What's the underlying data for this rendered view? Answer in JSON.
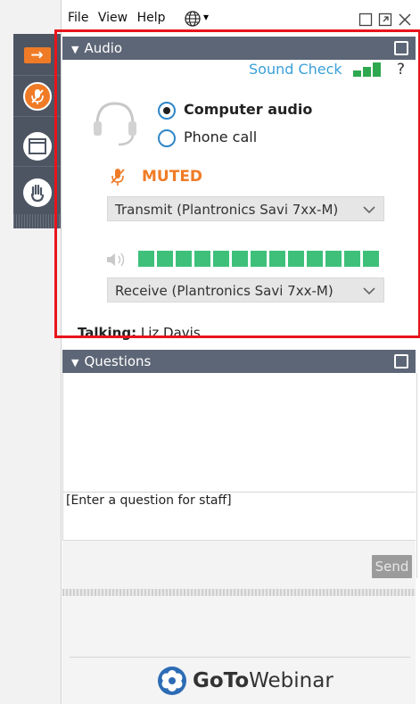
{
  "menu": {
    "file": "File",
    "view": "View",
    "help": "Help",
    "globe_icon": "globe-icon",
    "globe_caret": "▾"
  },
  "window_controls": [
    "restore-icon",
    "popout-icon",
    "close-icon"
  ],
  "toolbar": {
    "icons": [
      "arrow-right-icon",
      "mic-muted-icon",
      "window-icon",
      "raise-hand-icon"
    ],
    "accent": "#f07b26"
  },
  "audio": {
    "header": "Audio",
    "sound_check": "Sound Check",
    "help_mark": "?",
    "options": [
      {
        "label": "Computer audio",
        "selected": true
      },
      {
        "label": "Phone call",
        "selected": false
      }
    ],
    "status": "MUTED",
    "transmit_device": "Transmit (Plantronics Savi 7xx-M)",
    "receive_device": "Receive (Plantronics Savi 7xx-M)",
    "speaker_level_blocks": 13,
    "signal_bars": 3
  },
  "talking": {
    "label": "Talking:",
    "name": "Liz Davis"
  },
  "questions": {
    "header": "Questions",
    "placeholder": "[Enter a question for staff]",
    "send": "Send"
  },
  "branding": {
    "goto": "GoTo",
    "product": "Webinar"
  },
  "colors": {
    "header_bg": "#5d6676",
    "highlight_border": "#e8141c",
    "link": "#3aa0d8",
    "meter": "#3ec07a"
  }
}
